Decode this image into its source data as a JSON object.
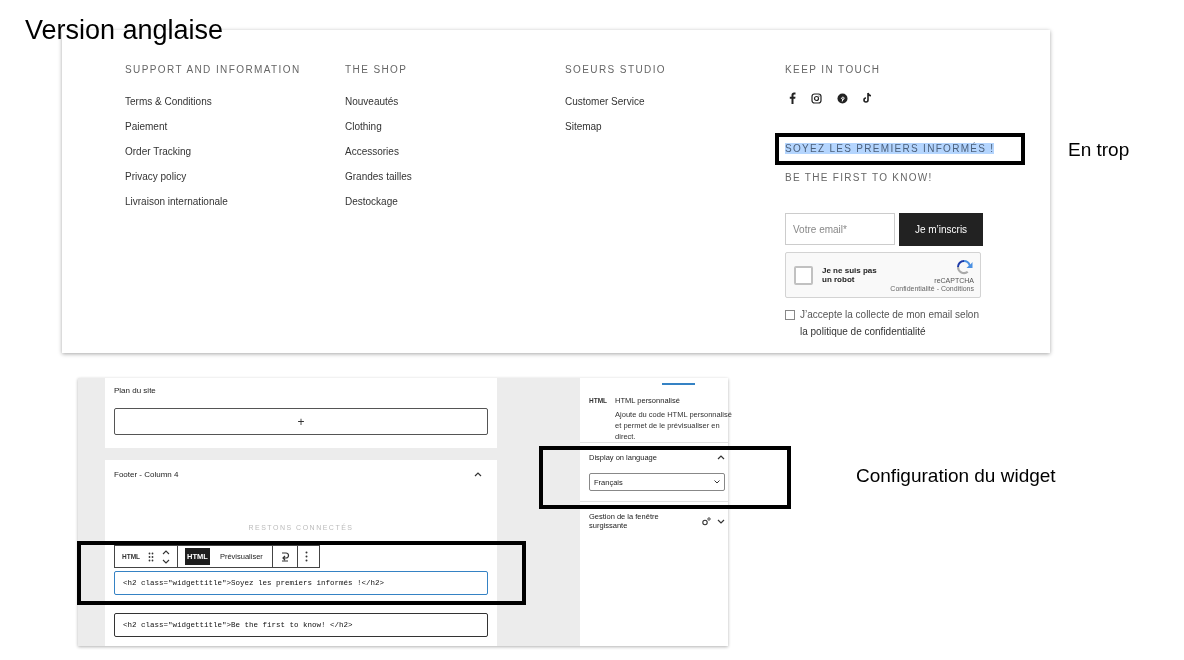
{
  "title": "Version anglaise",
  "footer": {
    "columns": [
      {
        "heading": "SUPPORT AND INFORMATION",
        "links": [
          "Terms & Conditions",
          "Paiement",
          "Order Tracking",
          "Privacy policy",
          "Livraison internationale"
        ]
      },
      {
        "heading": "THE SHOP",
        "links": [
          "Nouveautés",
          "Clothing",
          "Accessories",
          "Grandes tailles",
          "Destockage"
        ]
      },
      {
        "heading": "SOEURS STUDIO",
        "links": [
          "Customer Service",
          "Sitemap"
        ]
      }
    ],
    "keep_in_touch": {
      "heading": "KEEP IN TOUCH",
      "titles": [
        {
          "text": "SOYEZ LES PREMIERS INFORMÉS !",
          "highlighted": true
        },
        {
          "text": "BE THE FIRST TO KNOW!",
          "highlighted": false
        }
      ],
      "email": {
        "placeholder": "Votre email*"
      },
      "button": "Je m’inscris",
      "captcha": {
        "label": "Je ne suis pas un robot",
        "checked": false,
        "brand": "reCAPTCHA",
        "terms": "Confidentialité - Conditions"
      },
      "consent": {
        "checked": false,
        "lines": [
          "J’accepte la collecte de mon email selon",
          "la politique de confidentialité"
        ]
      }
    }
  },
  "annotations": [
    "En trop",
    "Configuration du widget"
  ],
  "editor": {
    "site_map": {
      "title": "Plan du site",
      "add": "+"
    },
    "footer_column": {
      "title": "Footer - Column 4",
      "expanded": true,
      "faded_title": "RESTONS CONNECTÉS",
      "toolbar": {
        "badge": "HTML",
        "modes": [
          {
            "label": "HTML",
            "selected": true
          },
          {
            "label": "Prévisualiser",
            "selected": false
          }
        ]
      },
      "code_blocks": [
        {
          "code": "<h2 class=\"widgettitle\">Soyez les premiers informés !</h2>",
          "focused": true
        },
        {
          "code": "<h2 class=\"widgettitle\">Be the first to know! </h2>",
          "focused": false
        }
      ]
    },
    "sidebar": {
      "badge": "HTML",
      "block_name": "HTML personnalisé",
      "description": "Ajoute du code HTML personnalisé et permet de le prévisualiser en direct.",
      "panels": [
        {
          "title": "Display on language",
          "expanded": true,
          "select": "Français"
        },
        {
          "title": "Gestion de la fenêtre surgissante",
          "expanded": false
        }
      ]
    }
  }
}
